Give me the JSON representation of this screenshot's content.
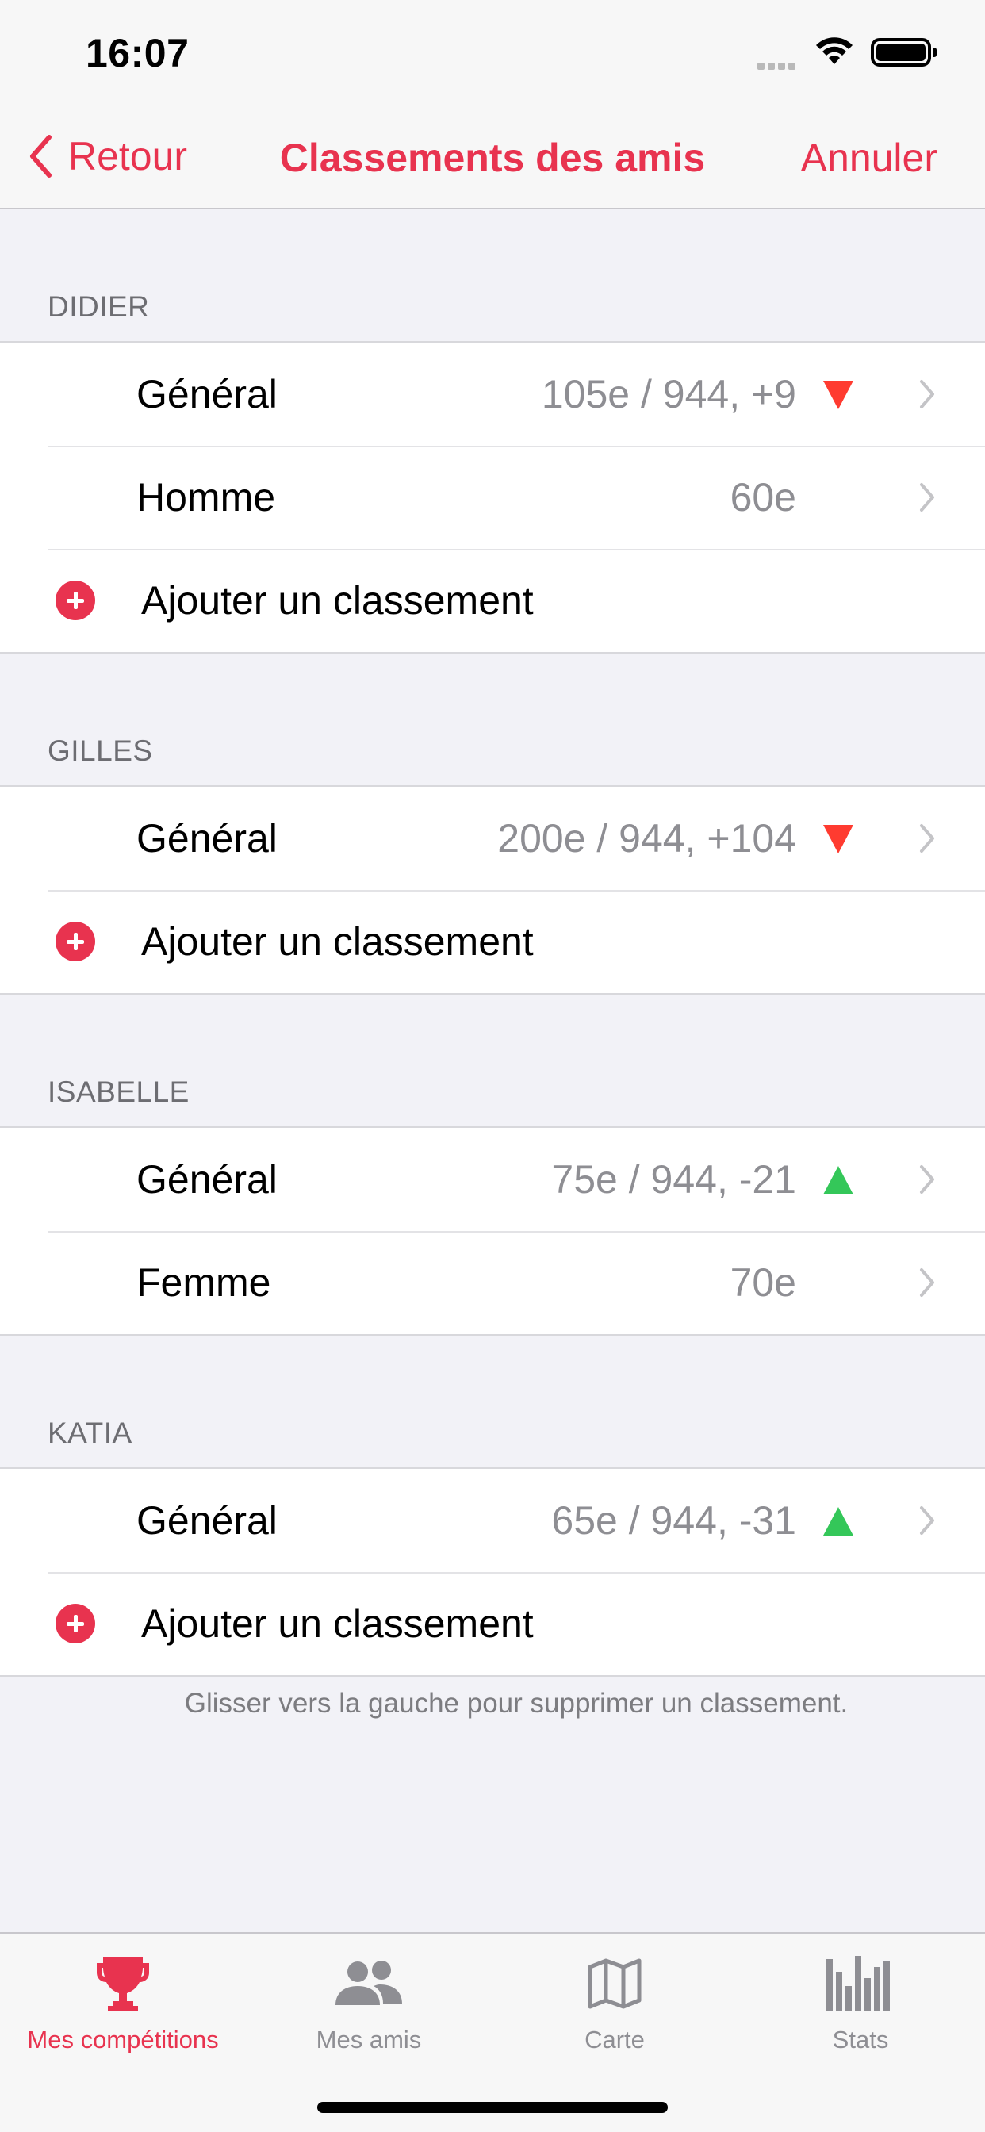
{
  "status_bar": {
    "time": "16:07"
  },
  "nav": {
    "back_label": "Retour",
    "title": "Classements des amis",
    "cancel_label": "Annuler"
  },
  "sections": [
    {
      "name": "DIDIER",
      "rows": [
        {
          "label": "Général",
          "value": "105e / 944, +9",
          "trend": "down"
        },
        {
          "label": "Homme",
          "value": "60e",
          "trend": ""
        }
      ],
      "add_label": "Ajouter un classement"
    },
    {
      "name": "GILLES",
      "rows": [
        {
          "label": "Général",
          "value": "200e / 944, +104",
          "trend": "down"
        }
      ],
      "add_label": "Ajouter un classement"
    },
    {
      "name": "ISABELLE",
      "rows": [
        {
          "label": "Général",
          "value": "75e / 944, -21",
          "trend": "up"
        },
        {
          "label": "Femme",
          "value": "70e",
          "trend": ""
        }
      ]
    },
    {
      "name": "KATIA",
      "rows": [
        {
          "label": "Général",
          "value": "65e / 944, -31",
          "trend": "up"
        }
      ],
      "add_label": "Ajouter un classement"
    }
  ],
  "footer_note": "Glisser vers la gauche pour supprimer un classement.",
  "tabs": [
    {
      "label": "Mes compétitions",
      "icon": "trophy-icon",
      "active": true
    },
    {
      "label": "Mes amis",
      "icon": "people-icon",
      "active": false
    },
    {
      "label": "Carte",
      "icon": "map-icon",
      "active": false
    },
    {
      "label": "Stats",
      "icon": "stats-icon",
      "active": false
    }
  ],
  "colors": {
    "accent": "#e8334f",
    "trend_down": "#ff3b30",
    "trend_up": "#34c759",
    "background": "#f2f2f7"
  }
}
